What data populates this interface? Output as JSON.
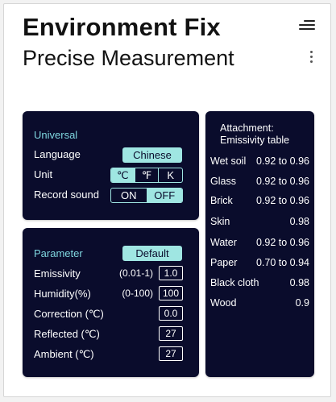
{
  "header": {
    "title": "Environment Fix",
    "subtitle": "Precise Measurement"
  },
  "icons": {
    "menu": "hamburger-menu-icon",
    "more": "vertical-dots-icon"
  },
  "colors": {
    "panel_bg": "#0a0c2c",
    "accent": "#9fe6e2",
    "section_title": "#7fd6df"
  },
  "universal": {
    "title": "Universal",
    "language_label": "Language",
    "language_value": "Chinese",
    "unit_label": "Unit",
    "unit_options": [
      "℃",
      "℉",
      "K"
    ],
    "unit_selected": "℃",
    "record_label": "Record sound",
    "record_options": [
      "ON",
      "OFF"
    ],
    "record_selected": "OFF"
  },
  "parameter": {
    "title": "Parameter",
    "default_label": "Default",
    "rows": [
      {
        "label": "Emissivity",
        "range": "(0.01-1)",
        "value": "1.0"
      },
      {
        "label": "Humidity(%)",
        "range": "(0-100)",
        "value": "100"
      },
      {
        "label": "Correction (℃)",
        "range": "",
        "value": "0.0"
      },
      {
        "label": "Reflected (℃)",
        "range": "",
        "value": "27"
      },
      {
        "label": "Ambient (℃)",
        "range": "",
        "value": "27"
      }
    ]
  },
  "attachment": {
    "title_line1": "Attachment:",
    "title_line2": "Emissivity table",
    "items": [
      {
        "name": "Wet soil",
        "value": "0.92 to 0.96"
      },
      {
        "name": "Glass",
        "value": "0.92 to 0.96"
      },
      {
        "name": "Brick",
        "value": "0.92 to 0.96"
      },
      {
        "name": "Skin",
        "value": "0.98"
      },
      {
        "name": "Water",
        "value": "0.92 to 0.96"
      },
      {
        "name": "Paper",
        "value": "0.70 to 0.94"
      },
      {
        "name": "Black cloth",
        "value": "0.98"
      },
      {
        "name": "Wood",
        "value": "0.9"
      }
    ]
  }
}
